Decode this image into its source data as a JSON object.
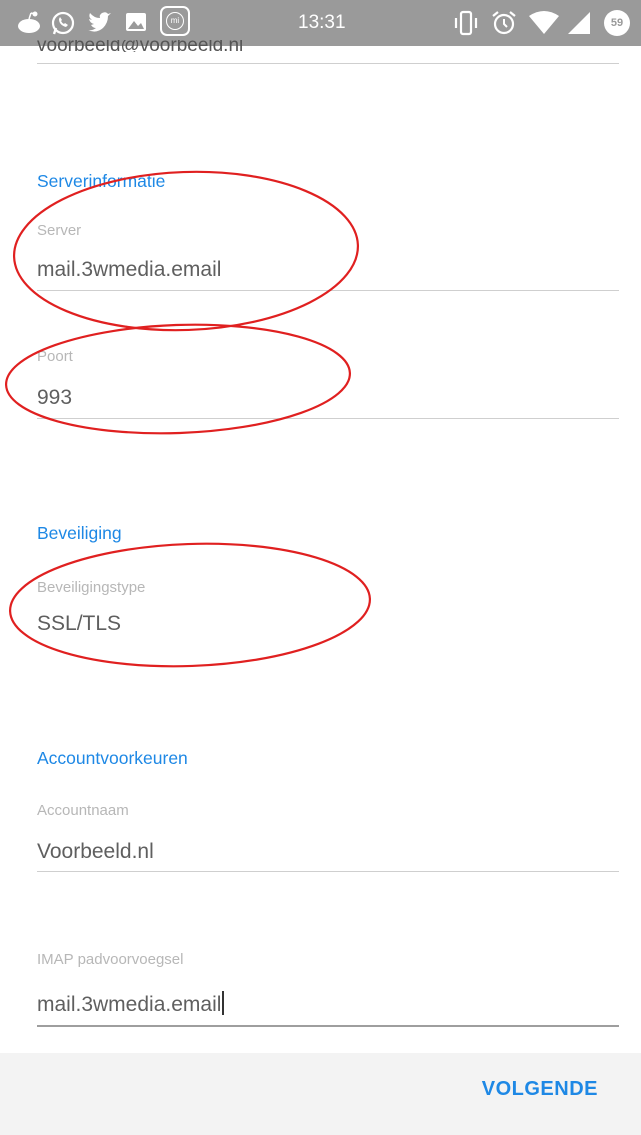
{
  "status_bar": {
    "time": "13:31",
    "battery": "59",
    "icons_left": [
      "reddit-icon",
      "whatsapp-icon",
      "twitter-icon",
      "gallery-icon",
      "mi-icon"
    ],
    "icons_right": [
      "vibrate-icon",
      "alarm-icon",
      "wifi-icon",
      "signal-icon",
      "battery-icon"
    ],
    "mi_label": "mi"
  },
  "form": {
    "email_value": "voorbeeld@voorbeeld.nl",
    "server_section": "Serverinformatie",
    "server_label": "Server",
    "server_value": "mail.3wmedia.email",
    "port_label": "Poort",
    "port_value": "993",
    "security_section": "Beveiliging",
    "security_type_label": "Beveiligingstype",
    "security_type_value": "SSL/TLS",
    "account_section": "Accountvoorkeuren",
    "account_name_label": "Accountnaam",
    "account_name_value": "Voorbeeld.nl",
    "imap_prefix_label": "IMAP padvoorvoegsel",
    "imap_prefix_value": "mail.3wmedia.email"
  },
  "footer": {
    "next_label": "VOLGENDE"
  },
  "colors": {
    "accent": "#1e88e5",
    "annotation": "#e02020",
    "status_bar": "#9a9a9a"
  }
}
